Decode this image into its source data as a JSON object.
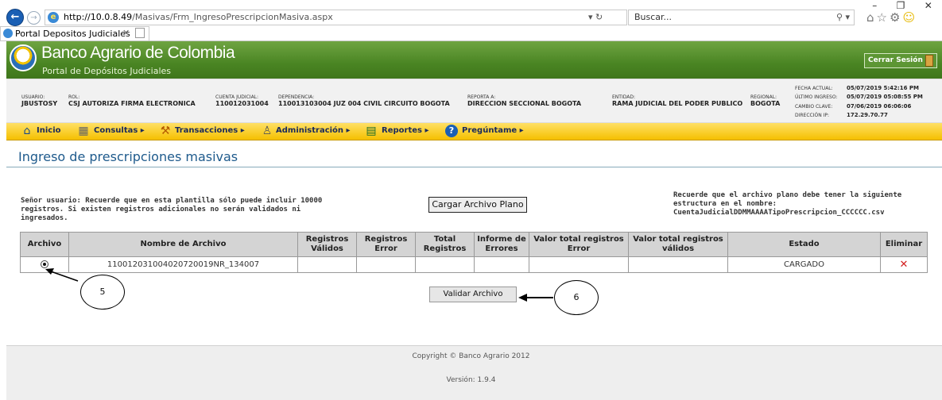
{
  "browser": {
    "url_host": "http://10.0.8.49",
    "url_path": "/Masivas/Frm_IngresoPrescripcionMasiva.aspx",
    "search_placeholder": "Buscar...",
    "tab_title": "Portal Depositos Judiciales",
    "window_controls": [
      "–",
      "❐",
      "✕"
    ]
  },
  "header": {
    "brand": "Banco Agrario de Colombia",
    "subtitle": "Portal de Depósitos Judiciales",
    "logout": "Cerrar Sesión"
  },
  "info": {
    "usuario_label": "USUARIO:",
    "usuario": "JBUSTOSY",
    "rol_label": "ROL:",
    "rol": "CSJ AUTORIZA FIRMA ELECTRONICA",
    "cuenta_label": "CUENTA JUDICIAL:",
    "cuenta": "110012031004",
    "dependencia_label": "DEPENDENCIA:",
    "dependencia": "110013103004 JUZ 004 CIVIL CIRCUITO BOGOTA",
    "reporta_label": "REPORTA A:",
    "reporta": "DIRECCION SECCIONAL BOGOTA",
    "entidad_label": "ENTIDAD:",
    "entidad": "RAMA JUDICIAL DEL PODER PUBLICO",
    "regional_label": "REGIONAL:",
    "regional": "BOGOTA",
    "fecha_label": "FECHA ACTUAL:",
    "fecha": "05/07/2019 5:42:16 PM",
    "ultimo_label": "ÚLTIMO INGRESO:",
    "ultimo": "05/07/2019 05:08:55 PM",
    "cambio_label": "CAMBIO CLAVE:",
    "cambio": "07/06/2019 06:06:06",
    "ip_label": "DIRECCIÓN IP:",
    "ip": "172.29.70.77"
  },
  "menu": {
    "inicio": "Inicio",
    "consultas": "Consultas",
    "transacciones": "Transacciones",
    "administracion": "Administración",
    "reportes": "Reportes",
    "preguntame": "Pregúntame"
  },
  "main": {
    "title": "Ingreso de prescripciones masivas",
    "notice": "Señor usuario: Recuerde que en esta plantilla sólo puede incluir 10000 registros. Si existen registros adicionales no serán validados ni ingresados.",
    "upload_button": "Cargar Archivo Plano",
    "notice_right": "Recuerde que el archivo plano debe tener la siguiente estructura en el nombre: CuentaJudicialDDMMAAAATipoPrescripcion_CCCCCC.csv",
    "validate_button": "Validar Archivo"
  },
  "table": {
    "headers": [
      "Archivo",
      "Nombre de Archivo",
      "Registros Válidos",
      "Registros Error",
      "Total Registros",
      "Informe de Errores",
      "Valor total registros Error",
      "Valor total registros válidos",
      "Estado",
      "Eliminar"
    ],
    "row": {
      "nombre": "110012031004020720019NR_134007",
      "estado": "CARGADO"
    }
  },
  "annotations": {
    "c5": "5",
    "c6": "6"
  },
  "footer": {
    "copyright": "Copyright © Banco Agrario 2012",
    "version": "Versión: 1.9.4"
  }
}
